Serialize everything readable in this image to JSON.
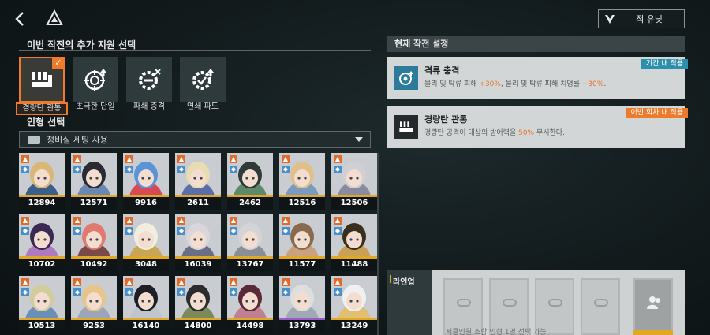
{
  "header": {
    "enemy_units_label": "적 유닛"
  },
  "support_section": {
    "title": "이번 작전의 추가 지원 선택",
    "options": [
      {
        "label": "경량탄 관통",
        "selected": true,
        "icon": "bullet-pierce-icon"
      },
      {
        "label": "초극한 단일",
        "selected": false,
        "icon": "crosshair-up-icon"
      },
      {
        "label": "파쇄 충격",
        "selected": false,
        "icon": "gear-shatter-icon"
      },
      {
        "label": "연쇄 파도",
        "selected": false,
        "icon": "gear-wave-icon"
      }
    ]
  },
  "doll_section": {
    "title": "인형 선택",
    "dropdown_value": "정비실 세팅 사용",
    "dolls": [
      {
        "value": "12894",
        "rank": "gold"
      },
      {
        "value": "12571",
        "rank": "gold"
      },
      {
        "value": "9916",
        "rank": "gold"
      },
      {
        "value": "2611",
        "rank": "gold"
      },
      {
        "value": "2462",
        "rank": "gold"
      },
      {
        "value": "12516",
        "rank": "gold"
      },
      {
        "value": "12506",
        "rank": "gold"
      },
      {
        "value": "10702",
        "rank": "gold"
      },
      {
        "value": "10492",
        "rank": "gold"
      },
      {
        "value": "3048",
        "rank": "gold"
      },
      {
        "value": "16039",
        "rank": "gold"
      },
      {
        "value": "13767",
        "rank": "gold"
      },
      {
        "value": "11577",
        "rank": "gold"
      },
      {
        "value": "11488",
        "rank": "gold"
      },
      {
        "value": "10513",
        "rank": "gold"
      },
      {
        "value": "9253",
        "rank": "gold"
      },
      {
        "value": "16140",
        "rank": "gold"
      },
      {
        "value": "14800",
        "rank": "gold"
      },
      {
        "value": "14498",
        "rank": "gold"
      },
      {
        "value": "13793",
        "rank": "purple"
      },
      {
        "value": "13249",
        "rank": "gold"
      }
    ]
  },
  "current_settings": {
    "title": "현재 작전 설정",
    "cards": [
      {
        "title": "격류 충격",
        "badge": "기간 내 적용",
        "desc_parts": [
          "물리 및 탁류 피해 ",
          "+30%",
          ", 물리 및 탁류 피해 치명률 ",
          "+30%",
          "."
        ]
      },
      {
        "title": "경량탄 관통",
        "badge": "이번 회차 내 적용",
        "desc_parts": [
          "경량탄 공격이 대상의 방어력을 ",
          "50%",
          " 무시한다."
        ]
      }
    ]
  },
  "lineup": {
    "title": "라인업",
    "hint": "서클인원 조합 인형 1명 선택 가능"
  },
  "colors": {
    "accent_orange": "#ef7a2a",
    "badge_cyan": "#2d8fae",
    "rank_gold": "#e3a726"
  }
}
